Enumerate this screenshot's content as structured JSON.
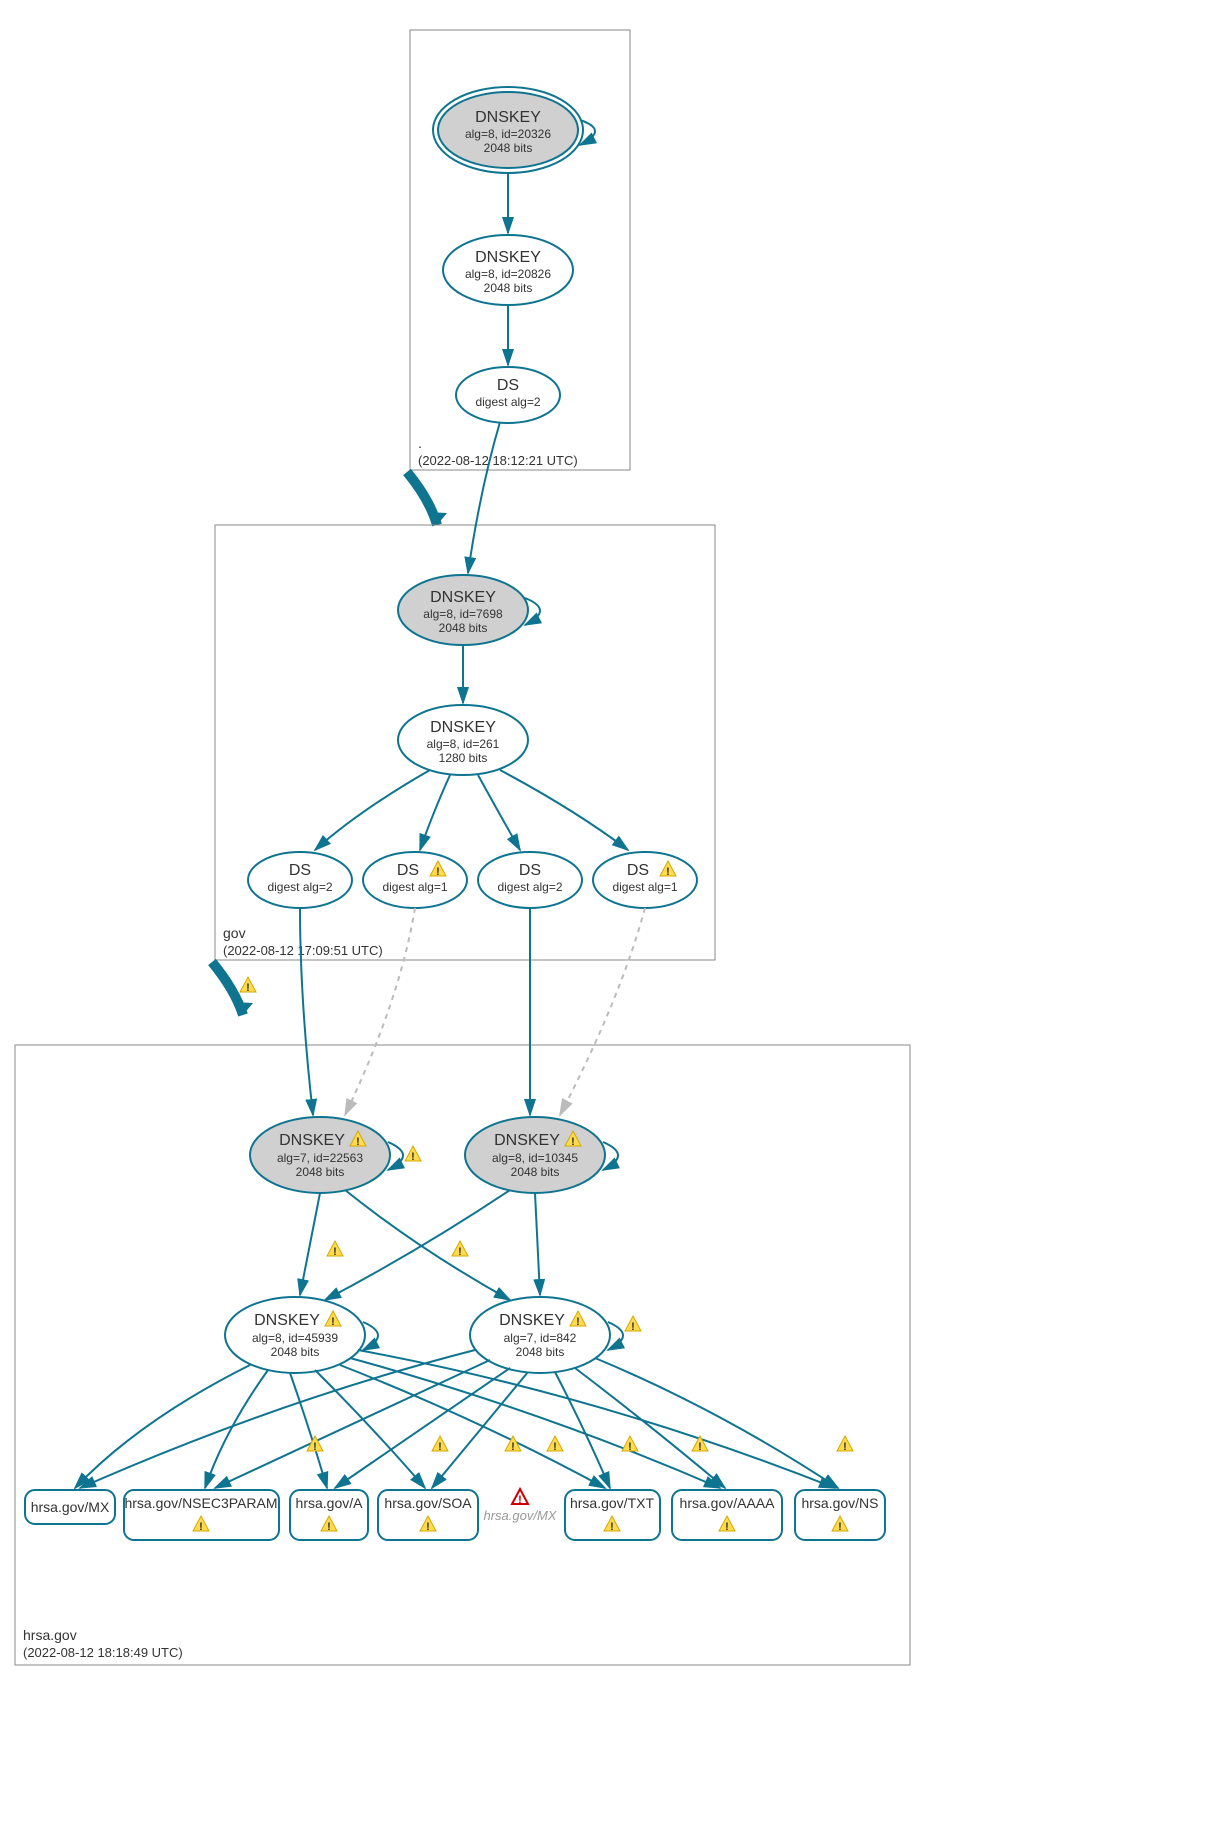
{
  "zones": {
    "root": {
      "name": ".",
      "timestamp": "(2022-08-12 18:12:21 UTC)"
    },
    "gov": {
      "name": "gov",
      "timestamp": "(2022-08-12 17:09:51 UTC)"
    },
    "hrsa": {
      "name": "hrsa.gov",
      "timestamp": "(2022-08-12 18:18:49 UTC)"
    }
  },
  "nodes": {
    "root_dnskey1": {
      "title": "DNSKEY",
      "line1": "alg=8, id=20326",
      "line2": "2048 bits"
    },
    "root_dnskey2": {
      "title": "DNSKEY",
      "line1": "alg=8, id=20826",
      "line2": "2048 bits"
    },
    "root_ds": {
      "title": "DS",
      "line1": "digest alg=2"
    },
    "gov_dnskey1": {
      "title": "DNSKEY",
      "line1": "alg=8, id=7698",
      "line2": "2048 bits"
    },
    "gov_dnskey2": {
      "title": "DNSKEY",
      "line1": "alg=8, id=261",
      "line2": "1280 bits"
    },
    "gov_ds1": {
      "title": "DS",
      "line1": "digest alg=2"
    },
    "gov_ds2": {
      "title": "DS",
      "line1": "digest alg=1"
    },
    "gov_ds3": {
      "title": "DS",
      "line1": "digest alg=2"
    },
    "gov_ds4": {
      "title": "DS",
      "line1": "digest alg=1"
    },
    "hrsa_dnskey1": {
      "title": "DNSKEY",
      "line1": "alg=7, id=22563",
      "line2": "2048 bits"
    },
    "hrsa_dnskey2": {
      "title": "DNSKEY",
      "line1": "alg=8, id=10345",
      "line2": "2048 bits"
    },
    "hrsa_dnskey3": {
      "title": "DNSKEY",
      "line1": "alg=8, id=45939",
      "line2": "2048 bits"
    },
    "hrsa_dnskey4": {
      "title": "DNSKEY",
      "line1": "alg=7, id=842",
      "line2": "2048 bits"
    }
  },
  "rrsets": {
    "mx": "hrsa.gov/MX",
    "nsec3param": "hrsa.gov/NSEC3PARAM",
    "a": "hrsa.gov/A",
    "soa": "hrsa.gov/SOA",
    "mx_ghost": "hrsa.gov/MX",
    "txt": "hrsa.gov/TXT",
    "aaaa": "hrsa.gov/AAAA",
    "ns": "hrsa.gov/NS"
  },
  "error_icon_label": "⚠"
}
